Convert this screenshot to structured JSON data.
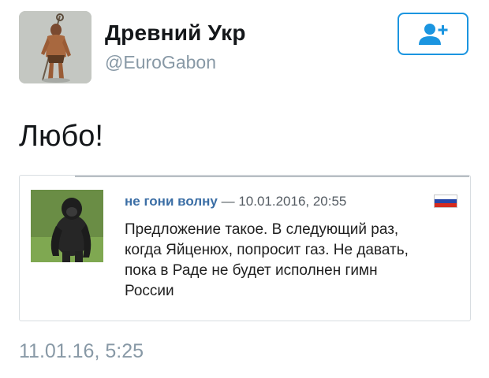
{
  "author": {
    "display_name": "Древний Укр",
    "handle": "@EuroGabon",
    "avatar_icon": "caveman-avatar-icon"
  },
  "follow_button": {
    "icon": "add-user-icon",
    "color": "#1b95e0"
  },
  "tweet": {
    "text": "Любо!",
    "timestamp": "11.01.16, 5:25"
  },
  "quote": {
    "username": "не гони волну",
    "separator": "—",
    "datetime": "10.01.2016, 20:55",
    "avatar_icon": "gorilla-avatar-icon",
    "flag_icon": "russian-flag-icon",
    "flag_colors": [
      "#ffffff",
      "#2646a8",
      "#d52b1e"
    ],
    "body_lines": [
      "Предложение такое. В следующий раз,",
      "когда Яйценюх, попросит газ. Не давать,",
      "пока в Раде не будет исполнен гимн",
      "России"
    ]
  }
}
